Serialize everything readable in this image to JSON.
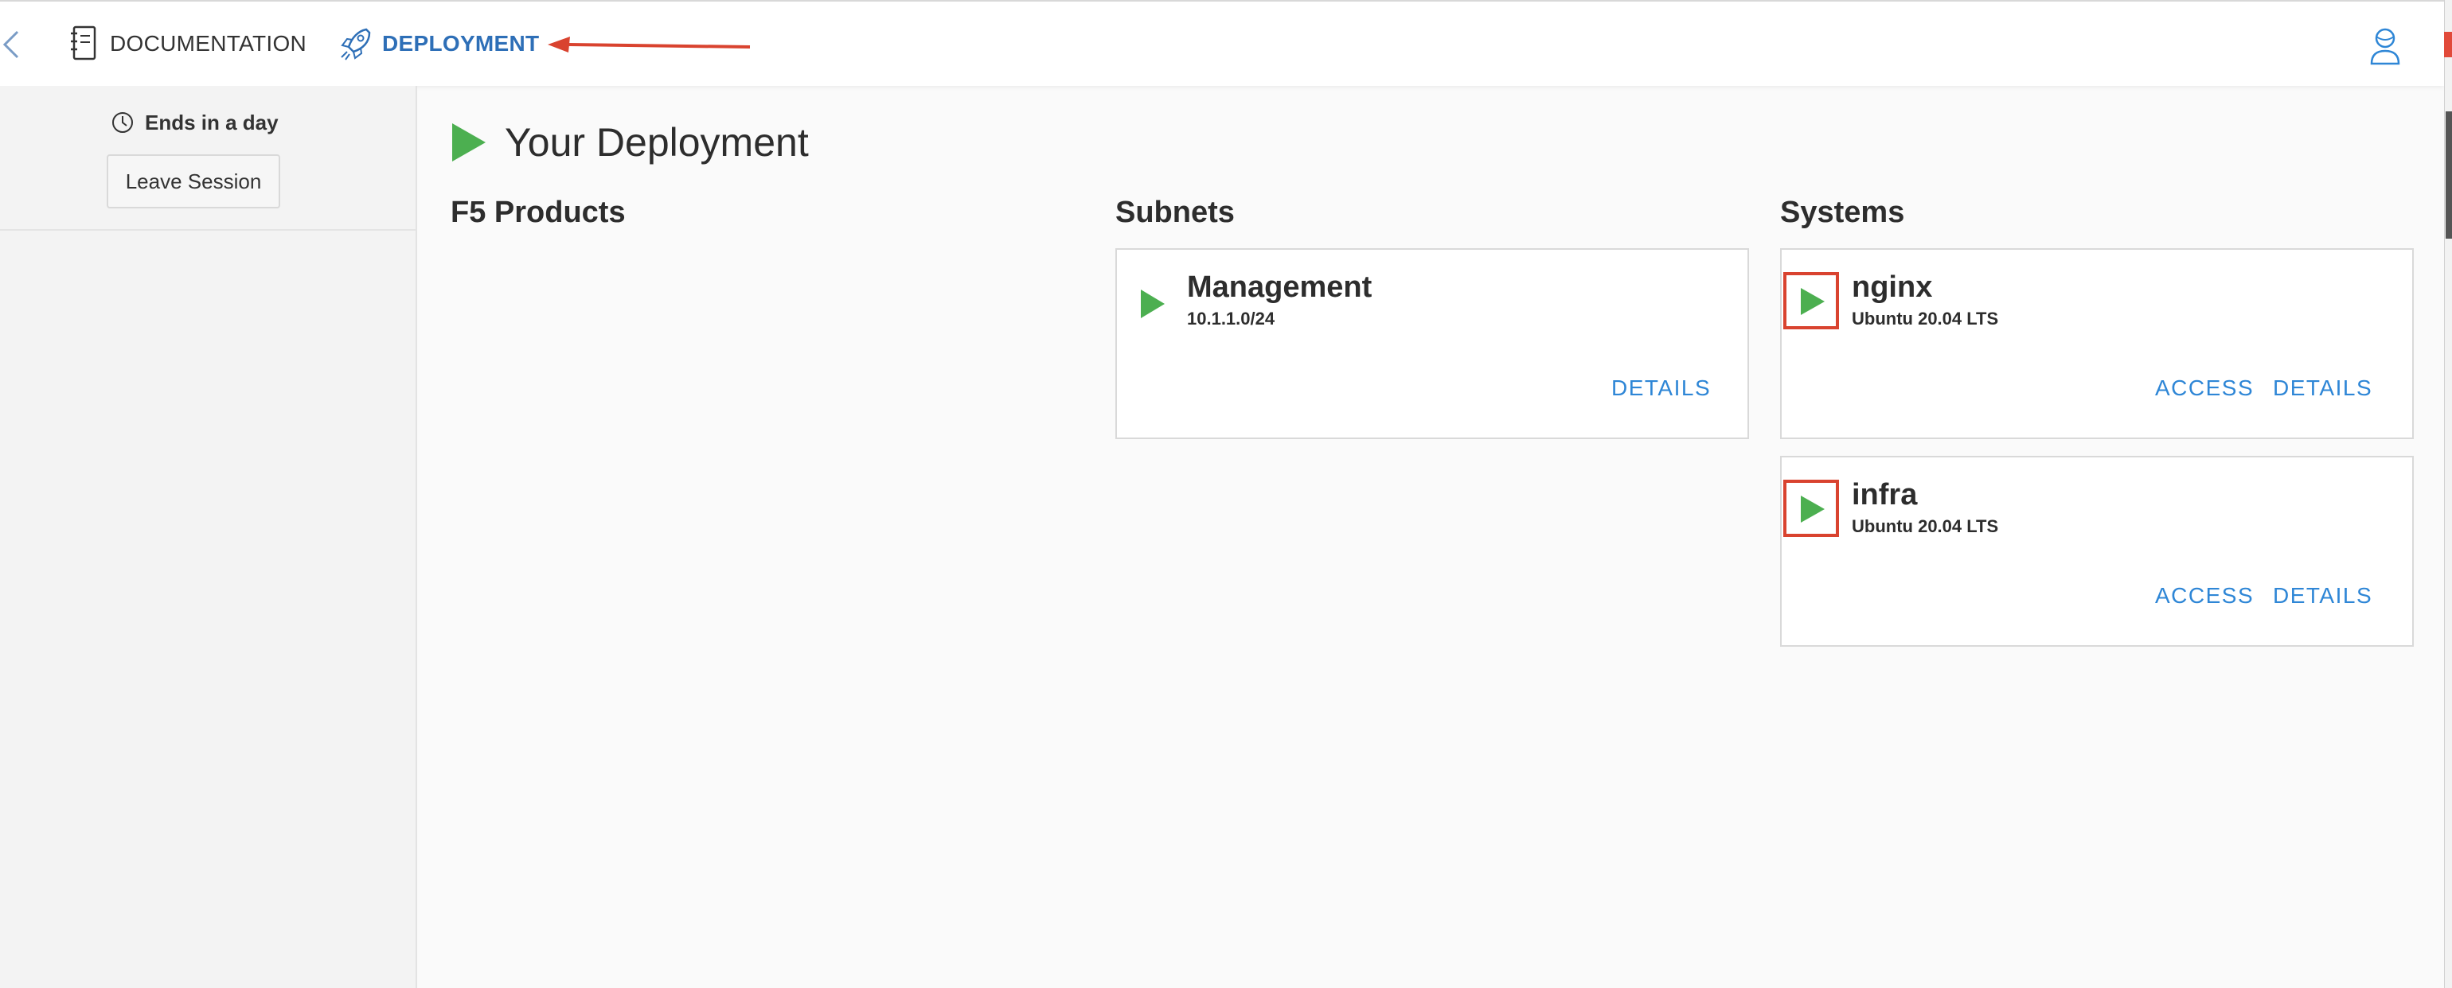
{
  "header": {
    "nav": [
      {
        "label": "DOCUMENTATION",
        "icon": "notebook-icon"
      },
      {
        "label": "DEPLOYMENT",
        "icon": "rocket-icon",
        "active": true
      }
    ],
    "user_icon": "user-icon",
    "accent_color": "#2e6fb7"
  },
  "sidebar": {
    "timer_label": "Ends in a day",
    "leave_button": "Leave Session"
  },
  "main": {
    "title": "Your Deployment",
    "columns": {
      "f5_products": "F5 Products",
      "subnets": "Subnets",
      "systems": "Systems"
    },
    "subnets": [
      {
        "name": "Management",
        "cidr": "10.1.1.0/24",
        "details": "DETAILS"
      }
    ],
    "systems": [
      {
        "name": "nginx",
        "os": "Ubuntu 20.04 LTS",
        "access": "ACCESS",
        "details": "DETAILS"
      },
      {
        "name": "infra",
        "os": "Ubuntu 20.04 LTS",
        "access": "ACCESS",
        "details": "DETAILS"
      }
    ],
    "status_color": "#4caf50",
    "link_color": "#2e86d6"
  }
}
